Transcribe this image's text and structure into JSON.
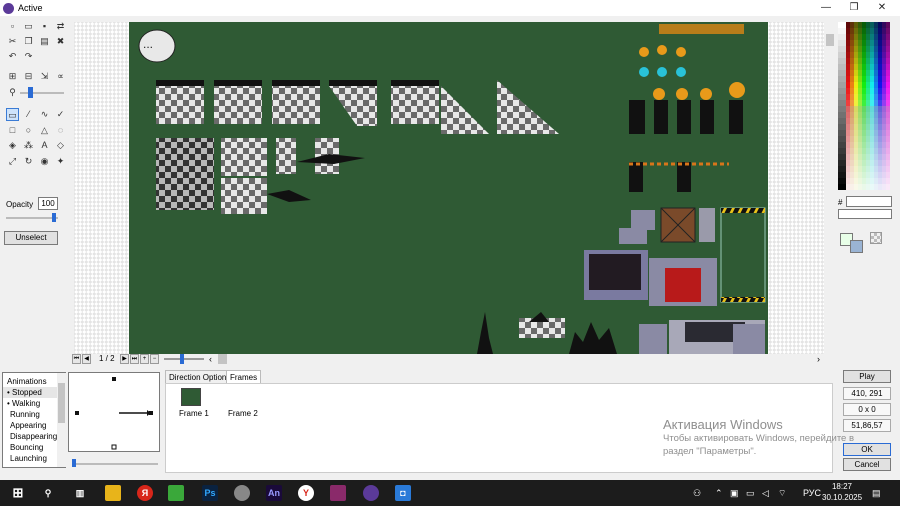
{
  "window": {
    "title": "Active",
    "controls": [
      "—",
      "❐",
      "✕"
    ]
  },
  "tools": {
    "opacity_label": "Opacity",
    "opacity_value": "100",
    "unselect_label": "Unselect"
  },
  "canvas": {
    "frame_counter": "1 / 2",
    "speech_bubble": "..."
  },
  "palette": {
    "hex_label": "#"
  },
  "animations": {
    "header": "Animations",
    "items": [
      "• Stopped",
      "• Walking",
      "Running",
      "Appearing",
      "Disappearing",
      "Bouncing",
      "Launching"
    ]
  },
  "tabs": [
    {
      "label": "Direction Options"
    },
    {
      "label": "Frames"
    }
  ],
  "frames": [
    {
      "label": "Frame 1"
    },
    {
      "label": "Frame 2"
    }
  ],
  "right_panel": {
    "play_label": "Play",
    "hotspot": "410, 291",
    "size": "0 x 0",
    "color": "51,86,57",
    "ok_label": "OK",
    "cancel_label": "Cancel"
  },
  "watermark": {
    "line1": "Активация Windows",
    "line2": "Чтобы активировать Windows, перейдите в",
    "line3": "раздел \"Параметры\"."
  },
  "taskbar": {
    "language": "РУС",
    "time": "18:27",
    "date": "30.10.2025"
  },
  "colors": {
    "canvas_bg": "#2f5a34",
    "accent": "#2a6bd4"
  }
}
